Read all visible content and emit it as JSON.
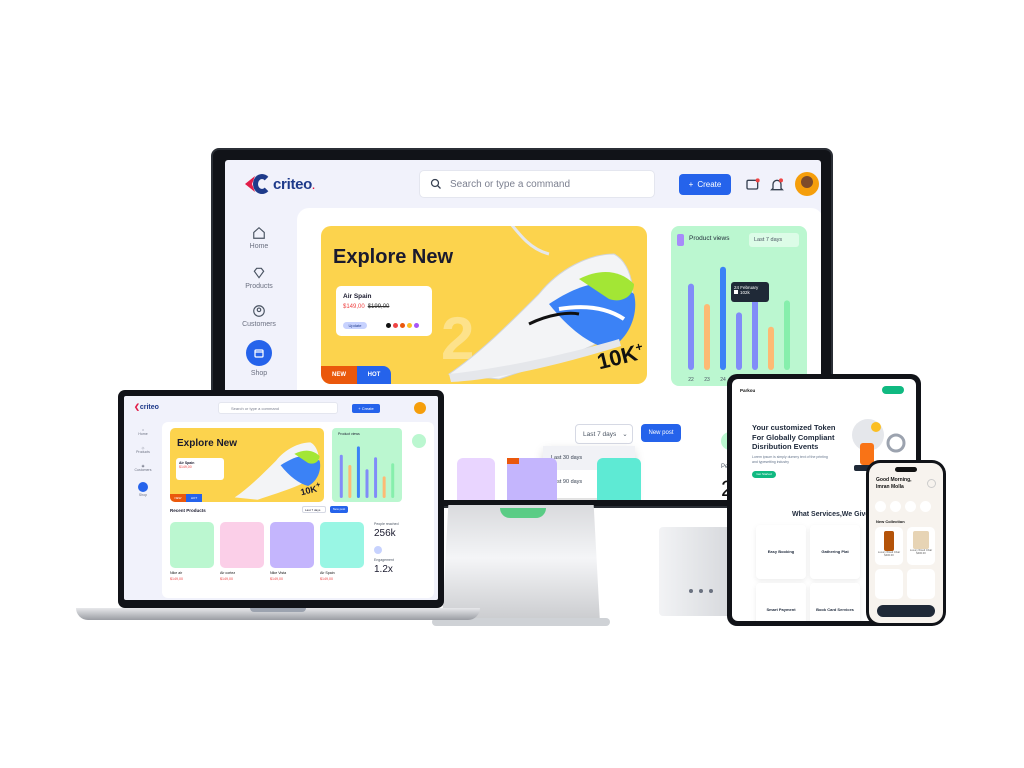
{
  "brand": {
    "name": "criteo",
    "dot": "."
  },
  "search": {
    "placeholder": "Search or type a command"
  },
  "header": {
    "create_label": "Create"
  },
  "sidebar": {
    "items": [
      {
        "label": "Home",
        "icon": "home-icon"
      },
      {
        "label": "Products",
        "icon": "diamond-icon"
      },
      {
        "label": "Customers",
        "icon": "user-circle-icon"
      },
      {
        "label": "Shop",
        "icon": "shop-icon"
      }
    ]
  },
  "hero": {
    "title": "Explore New",
    "product_name": "Air Spain",
    "price_now": "$149,00",
    "price_old": "$199,00",
    "pill": "Update",
    "badge_new": "NEW",
    "badge_hot": "HOT",
    "stamp": "10K",
    "stamp_sup": "+",
    "watermark": "2",
    "colors": [
      "#111111",
      "#ef4444",
      "#ea580c",
      "#fbbf24",
      "#a855f7"
    ]
  },
  "product_views": {
    "title": "Product views",
    "range": "Last 7 days",
    "tooltip_date": "24 February",
    "tooltip_value": "102k",
    "x_labels": [
      "22",
      "23",
      "24",
      "25",
      "26",
      "27",
      "28"
    ]
  },
  "chart_data": {
    "type": "bar",
    "title": "Product views",
    "categories": [
      "22",
      "23",
      "24",
      "25",
      "26",
      "27",
      "28"
    ],
    "series": [
      {
        "values": [
          72,
          55,
          86,
          48,
          68,
          36,
          58
        ]
      },
      {
        "values": [
          0,
          0,
          0,
          0,
          0,
          0,
          0
        ]
      }
    ],
    "ylim": [
      0,
      100
    ]
  },
  "dropdown": {
    "selected": "Last 7 days",
    "options": [
      "Last 30 days",
      "Last 90 days"
    ]
  },
  "new_post_label": "New post",
  "stats": {
    "people_label": "People",
    "people_value": "25"
  },
  "laptop": {
    "section_title": "Recent Products",
    "people_reached_label": "People reached",
    "people_reached": "256k",
    "engagement_label": "Engagement",
    "engagement": "1.2x",
    "products": [
      {
        "name": "Nike air",
        "price": "$149,00",
        "bg": "#bbf7d0"
      },
      {
        "name": "Air cortez",
        "price": "$149,00",
        "bg": "#fbcfe8"
      },
      {
        "name": "Nike Vista",
        "price": "$149,00",
        "bg": "#c4b5fd"
      },
      {
        "name": "Air Spain",
        "price": "$149,00",
        "bg": "#99f6e4"
      }
    ]
  },
  "tablet": {
    "brand": "Parkou",
    "headline": "Your customized Token For Globally Compliant Disribution Events",
    "sub": "Lorem ipsum is simply dummy text of the printing and typesetting industry",
    "cta": "Get Started",
    "services_title": "What Services,We Give Yo",
    "services": [
      {
        "name": "Easy Booking"
      },
      {
        "name": "Gathering Plat"
      },
      {
        "name": "Smart Payment"
      },
      {
        "name": "Book Card Services"
      }
    ]
  },
  "phone": {
    "greeting": "Good Morning, Imran Molla",
    "collection": "New Collection",
    "items": [
      {
        "name": "Luxury Wood Chair",
        "price": "$400.00"
      },
      {
        "name": "Luxury Wood Chair",
        "price": "$400.00"
      }
    ]
  }
}
